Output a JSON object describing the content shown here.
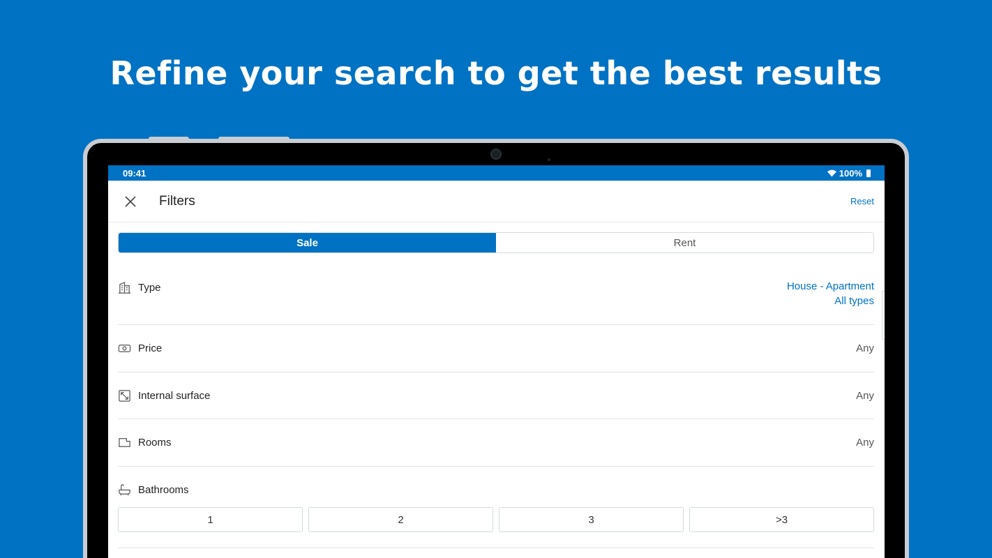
{
  "headline": "Refine your search to get the best results",
  "statusbar": {
    "time": "09:41",
    "battery": "100%"
  },
  "appbar": {
    "title": "Filters",
    "reset": "Reset",
    "close_icon": "close-icon"
  },
  "tabs": [
    {
      "label": "Sale",
      "active": true
    },
    {
      "label": "Rent",
      "active": false
    }
  ],
  "filters": {
    "type": {
      "label": "Type",
      "value_line1": "House - Apartment",
      "value_line2": "All types",
      "icon": "building-icon"
    },
    "price": {
      "label": "Price",
      "value": "Any",
      "icon": "money-icon"
    },
    "surface": {
      "label": "Internal surface",
      "value": "Any",
      "icon": "resize-icon"
    },
    "rooms": {
      "label": "Rooms",
      "value": "Any",
      "icon": "room-icon"
    },
    "bathrooms": {
      "label": "Bathrooms",
      "icon": "bathtub-icon",
      "options": [
        "1",
        "2",
        "3",
        ">3"
      ]
    }
  },
  "colors": {
    "brand": "#0072c3",
    "text": "#222222",
    "muted": "#555555"
  }
}
